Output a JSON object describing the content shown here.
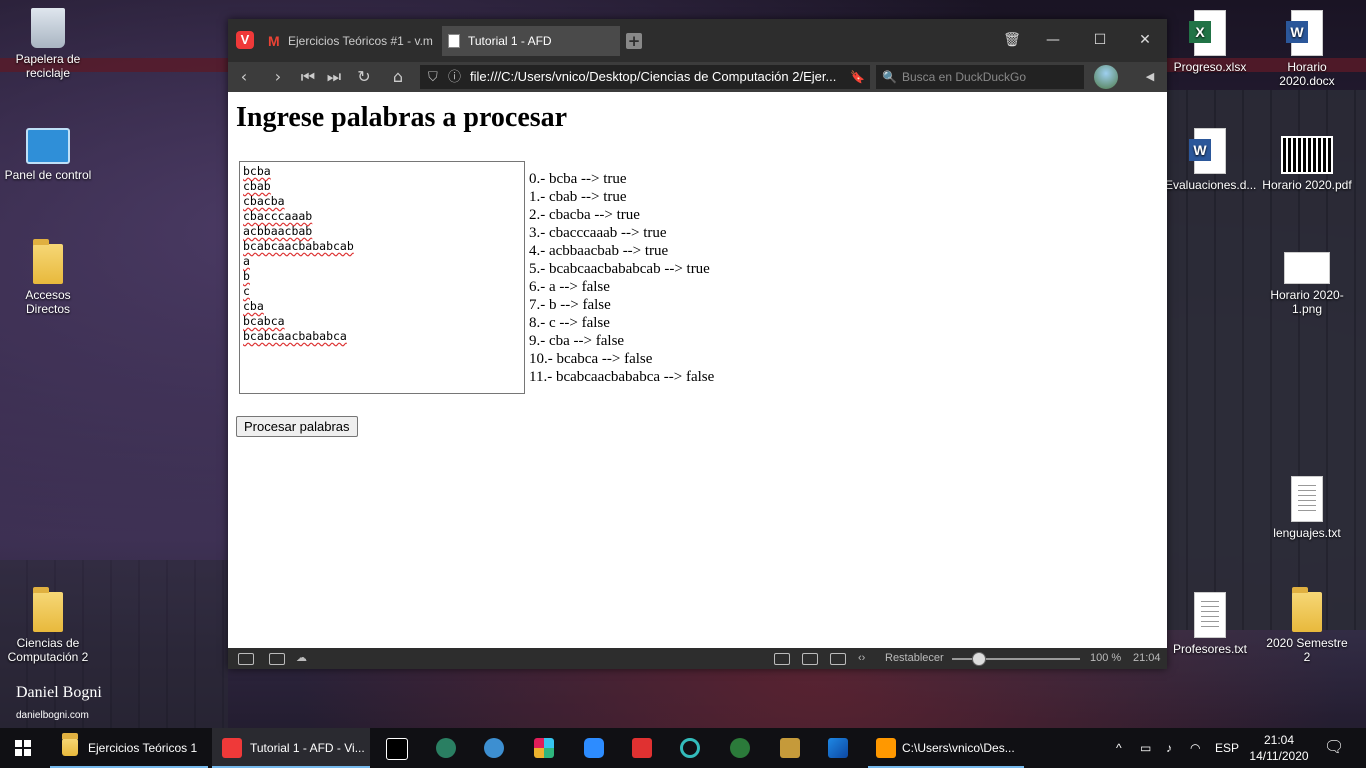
{
  "desktop": {
    "icons_left": [
      {
        "label": "Papelera de reciclaje",
        "icon": "recycle-bin-icon"
      },
      {
        "label": "Panel de control",
        "icon": "control-panel-icon"
      },
      {
        "label": "Accesos Directos",
        "icon": "folder-icon"
      },
      {
        "label": "Ciencias de Computación 2",
        "icon": "folder-icon"
      }
    ],
    "icons_right": [
      {
        "label": "Progreso.xlsx",
        "icon": "excel-file-icon"
      },
      {
        "label": "Horario 2020.docx",
        "icon": "word-file-icon"
      },
      {
        "label": "Evaluaciones.d...",
        "icon": "word-file-icon"
      },
      {
        "label": "Horario 2020.pdf",
        "icon": "pdf-file-icon"
      },
      {
        "label": "Horario 2020-1.png",
        "icon": "image-file-icon"
      },
      {
        "label": "lenguajes.txt",
        "icon": "text-file-icon"
      },
      {
        "label": "Profesores.txt",
        "icon": "text-file-icon"
      },
      {
        "label": "2020 Semestre 2",
        "icon": "folder-icon"
      }
    ],
    "watermark": {
      "name": "Daniel Bogni",
      "url": "danielbogni.com"
    }
  },
  "browser": {
    "tabs": [
      {
        "label": "Ejercicios Teóricos #1 - v.m",
        "icon": "gmail-icon",
        "active": false
      },
      {
        "label": "Tutorial 1 - AFD",
        "icon": "document-icon",
        "active": true
      }
    ],
    "address": "file:///C:/Users/vnico/Desktop/Ciencias de Computación 2/Ejer...",
    "search_placeholder": "Busca en DuckDuckGo",
    "status": {
      "reset_label": "Restablecer",
      "zoom": "100 %",
      "time": "21:04",
      "zoom_level": 0.2
    }
  },
  "page": {
    "heading": "Ingrese palabras a procesar",
    "words": [
      "bcba",
      "cbab",
      "cbacba",
      "cbacccaaab",
      "acbbaacbab",
      "bcabcaacbababcab",
      "a",
      "b",
      "c",
      "cba",
      "bcabca",
      "bcabcaacbababca"
    ],
    "results": [
      "0.- bcba --> true",
      "1.- cbab --> true",
      "2.- cbacba --> true",
      "3.- cbacccaaab --> true",
      "4.- acbbaacbab --> true",
      "5.- bcabcaacbababcab --> true",
      "6.- a --> false",
      "7.- b --> false",
      "8.- c --> false",
      "9.- cba --> false",
      "10.- bcabca --> false",
      "11.- bcabcaacbababca --> false"
    ],
    "button_label": "Procesar palabras"
  },
  "taskbar": {
    "items": [
      {
        "label": "Ejercicios Teóricos 1",
        "icon": "folder-icon",
        "state": "open"
      },
      {
        "label": "Tutorial 1 - AFD - Vi...",
        "icon": "vivaldi-icon",
        "state": "active"
      },
      {
        "label": "C:\\Users\\vnico\\Des...",
        "icon": "sublime-icon",
        "state": "open"
      }
    ],
    "lang": "ESP",
    "time": "21:04",
    "date": "14/11/2020"
  }
}
